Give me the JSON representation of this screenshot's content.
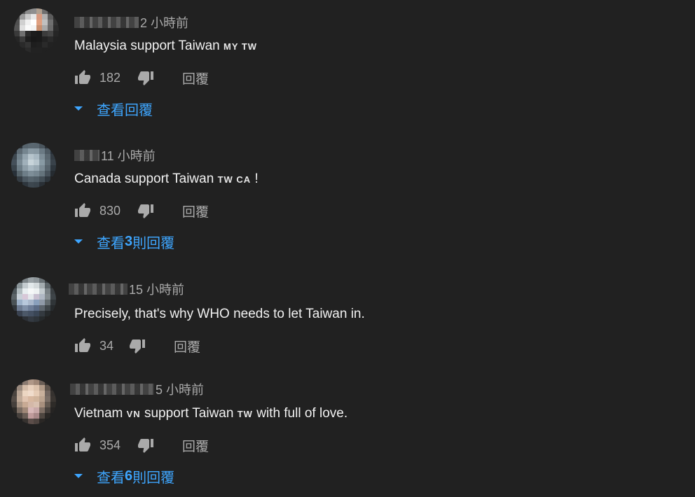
{
  "colors": {
    "background": "#212121",
    "link": "#3ea6ff",
    "meta": "#aaaaaa",
    "text": "#f1f1f1"
  },
  "comments": [
    {
      "time": "2 小時前",
      "text_parts": [
        "Malaysia support Taiwan ",
        "MY TW",
        ""
      ],
      "likes": "182",
      "reply_label": "回覆",
      "view_replies": {
        "prefix": "查看",
        "count": "",
        "suffix": "回覆"
      }
    },
    {
      "time": "11 小時前",
      "text_parts": [
        "Canada support Taiwan ",
        "TW CA",
        "  !"
      ],
      "likes": "830",
      "reply_label": "回覆",
      "view_replies": {
        "prefix": "查看 ",
        "count": "3",
        "suffix": " 則回覆"
      }
    },
    {
      "time": "15 小時前",
      "text_parts": [
        "Precisely, that's why WHO needs to let Taiwan in.",
        "",
        ""
      ],
      "likes": "34",
      "reply_label": "回覆"
    },
    {
      "time": "5 小時前",
      "text_parts": [
        "Vietnam ",
        "VN",
        " support Taiwan ",
        "TW",
        " with full of love."
      ],
      "likes": "354",
      "reply_label": "回覆",
      "view_replies": {
        "prefix": "查看 ",
        "count": "6",
        "suffix": " 則回覆"
      }
    }
  ],
  "icons": {
    "like": "thumbs-up-icon",
    "dislike": "thumbs-down-icon",
    "expand": "caret-down-icon"
  }
}
